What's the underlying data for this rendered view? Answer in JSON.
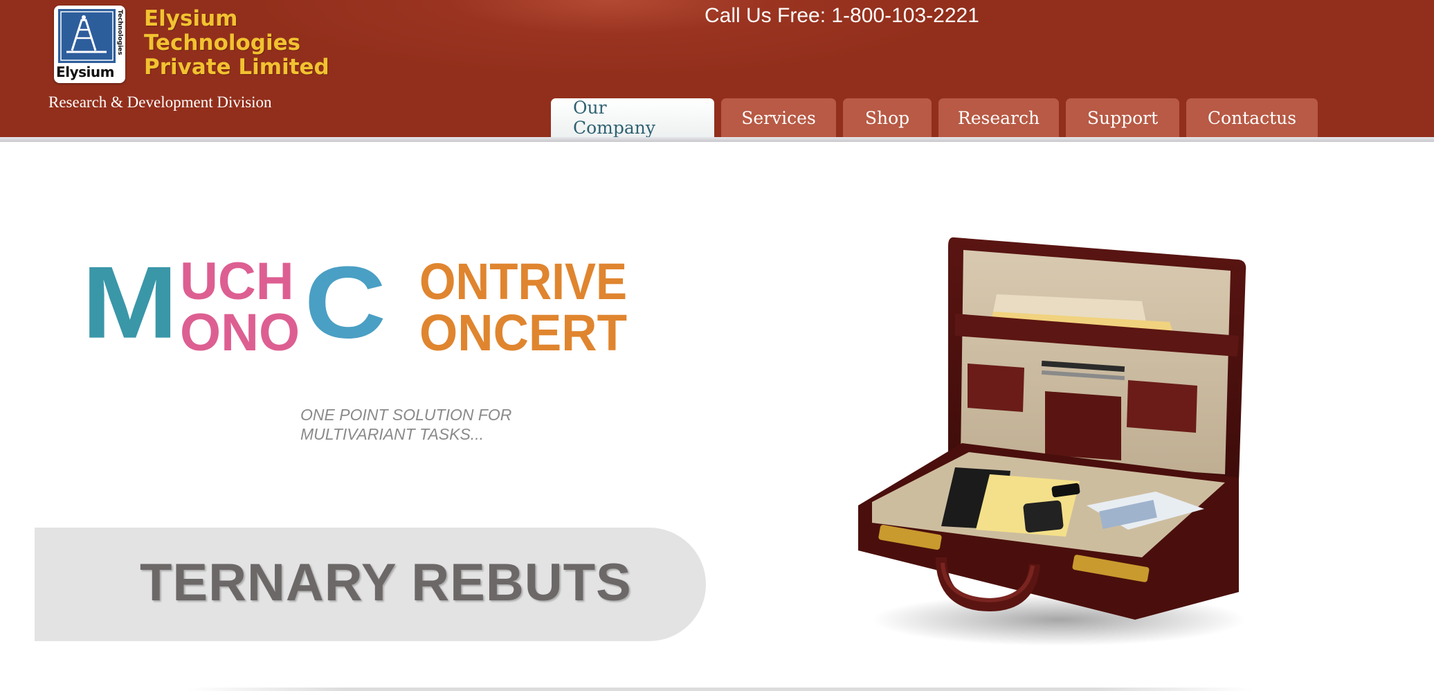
{
  "header": {
    "logo": {
      "word": "Elysium",
      "side_text": "Technologies",
      "icon": "tower-logo-icon"
    },
    "company_lines": [
      "Elysium",
      "Technologies",
      "Private Limited"
    ],
    "division": "Research & Development Division",
    "phone": "Call Us Free: 1-800-103-2221"
  },
  "nav": {
    "tabs": [
      {
        "label": "Our Company",
        "active": true
      },
      {
        "label": "Services",
        "active": false
      },
      {
        "label": "Shop",
        "active": false
      },
      {
        "label": "Research",
        "active": false
      },
      {
        "label": "Support",
        "active": false
      },
      {
        "label": "Contactus",
        "active": false
      }
    ]
  },
  "hero": {
    "brand": {
      "big_m": "M",
      "line1": "UCH",
      "line2": "ONO",
      "big_c": "C",
      "line3": "ONTRIVE",
      "line4": "ONCERT"
    },
    "tagline_lines": [
      "ONE POINT SOLUTION FOR",
      "MULTIVARIANT TASKS..."
    ],
    "banner_text": "TERNARY REBUTS",
    "image": "briefcase-image"
  },
  "colors": {
    "header_bg": "#922f1c",
    "company_text": "#f2c230",
    "tab_bg": "#b85a45",
    "active_tab_text": "#2f6273",
    "teal": "#3a97a8",
    "pink": "#dd5f92",
    "blue": "#4a9fc4",
    "orange": "#e0852f"
  }
}
